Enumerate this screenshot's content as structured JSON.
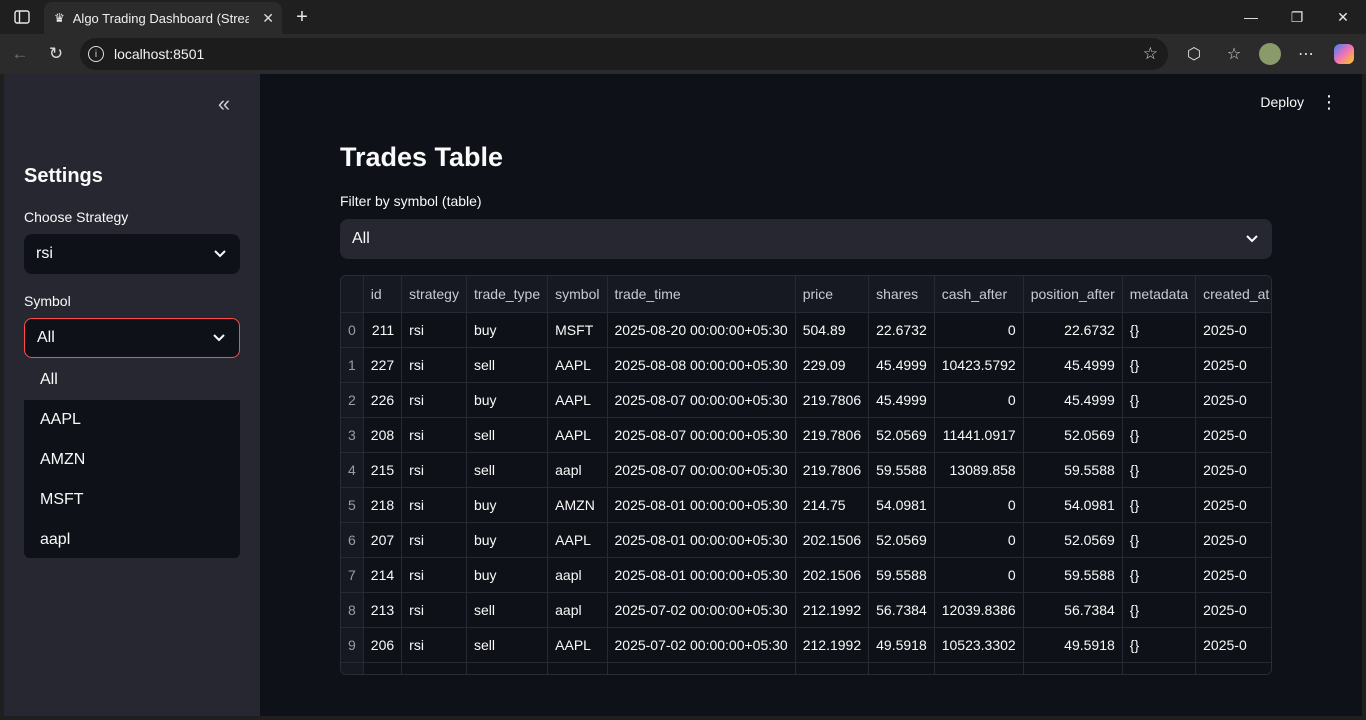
{
  "browser": {
    "tab_title": "Algo Trading Dashboard (Streamlit)",
    "url": "localhost:8501"
  },
  "sidebar": {
    "title": "Settings",
    "strategy_label": "Choose Strategy",
    "strategy_value": "rsi",
    "symbol_label": "Symbol",
    "symbol_value": "All",
    "symbol_options": [
      "All",
      "AAPL",
      "AMZN",
      "MSFT",
      "aapl"
    ]
  },
  "header": {
    "deploy_label": "Deploy"
  },
  "main": {
    "title": "Trades Table",
    "filter_label": "Filter by symbol (table)",
    "filter_value": "All"
  },
  "table": {
    "columns": [
      "",
      "id",
      "strategy",
      "trade_type",
      "symbol",
      "trade_time",
      "price",
      "shares",
      "cash_after",
      "position_after",
      "metadata",
      "created_at"
    ],
    "rows": [
      [
        "0",
        "211",
        "rsi",
        "buy",
        "MSFT",
        "2025-08-20 00:00:00+05:30",
        "504.89",
        "22.6732",
        "0",
        "22.6732",
        "{}",
        "2025-0"
      ],
      [
        "1",
        "227",
        "rsi",
        "sell",
        "AAPL",
        "2025-08-08 00:00:00+05:30",
        "229.09",
        "45.4999",
        "10423.5792",
        "45.4999",
        "{}",
        "2025-0"
      ],
      [
        "2",
        "226",
        "rsi",
        "buy",
        "AAPL",
        "2025-08-07 00:00:00+05:30",
        "219.7806",
        "45.4999",
        "0",
        "45.4999",
        "{}",
        "2025-0"
      ],
      [
        "3",
        "208",
        "rsi",
        "sell",
        "AAPL",
        "2025-08-07 00:00:00+05:30",
        "219.7806",
        "52.0569",
        "11441.0917",
        "52.0569",
        "{}",
        "2025-0"
      ],
      [
        "4",
        "215",
        "rsi",
        "sell",
        "aapl",
        "2025-08-07 00:00:00+05:30",
        "219.7806",
        "59.5588",
        "13089.858",
        "59.5588",
        "{}",
        "2025-0"
      ],
      [
        "5",
        "218",
        "rsi",
        "buy",
        "AMZN",
        "2025-08-01 00:00:00+05:30",
        "214.75",
        "54.0981",
        "0",
        "54.0981",
        "{}",
        "2025-0"
      ],
      [
        "6",
        "207",
        "rsi",
        "buy",
        "AAPL",
        "2025-08-01 00:00:00+05:30",
        "202.1506",
        "52.0569",
        "0",
        "52.0569",
        "{}",
        "2025-0"
      ],
      [
        "7",
        "214",
        "rsi",
        "buy",
        "aapl",
        "2025-08-01 00:00:00+05:30",
        "202.1506",
        "59.5588",
        "0",
        "59.5588",
        "{}",
        "2025-0"
      ],
      [
        "8",
        "213",
        "rsi",
        "sell",
        "aapl",
        "2025-07-02 00:00:00+05:30",
        "212.1992",
        "56.7384",
        "12039.8386",
        "56.7384",
        "{}",
        "2025-0"
      ],
      [
        "9",
        "206",
        "rsi",
        "sell",
        "AAPL",
        "2025-07-02 00:00:00+05:30",
        "212.1992",
        "49.5918",
        "10523.3302",
        "49.5918",
        "{}",
        "2025-0"
      ]
    ]
  },
  "colors": {
    "app_bg": "#0e1117",
    "sidebar_bg": "#262730",
    "focus_border": "#ff4b4b"
  }
}
